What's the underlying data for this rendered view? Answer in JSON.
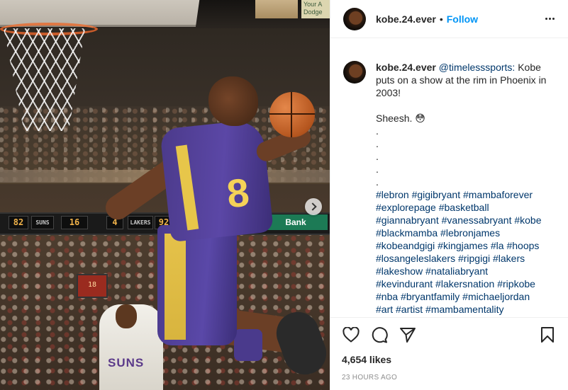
{
  "photo": {
    "scoreboard": [
      "82",
      "SUNS",
      "16",
      "4",
      "LAKERS",
      "92"
    ],
    "bank_sign": "Bank",
    "shot_clock": "18",
    "sign_text": "Your A Dodge",
    "jersey_number": "8",
    "opponent_jersey": "SUNS"
  },
  "header": {
    "username": "kobe.24.ever",
    "separator": "•",
    "follow_label": "Follow"
  },
  "caption": {
    "username": "kobe.24.ever",
    "mention": "@timelesssports:",
    "text_line1": "Kobe puts on a show at the rim in Phoenix in 2003!",
    "text_line2": "Sheesh. 😳",
    "dots": [
      ".",
      ".",
      ".",
      ".",
      "."
    ],
    "hashtags": [
      "#lebron #gigibryant #mambaforever",
      "#explorepage #basketball",
      "#giannabryant #vanessabryant #kobe",
      "#blackmamba #lebronjames",
      "#kobeandgigi #kingjames #la #hoops",
      "#losangeleslakers #ripgigi #lakers",
      "#lakeshow #nataliabryant",
      "#kevindurant #lakersnation #ripkobe",
      "#nba #bryantfamily #michaeljordan",
      "#art #artist #mambamentality"
    ]
  },
  "actions": {
    "like_icon": "heart-icon",
    "comment_icon": "comment-icon",
    "share_icon": "share-icon",
    "save_icon": "bookmark-icon",
    "likes": "4,654 likes",
    "timestamp": "23 HOURS AGO"
  },
  "colors": {
    "accent": "#0095f6",
    "link": "#00376b",
    "muted": "#8e8e8e"
  }
}
